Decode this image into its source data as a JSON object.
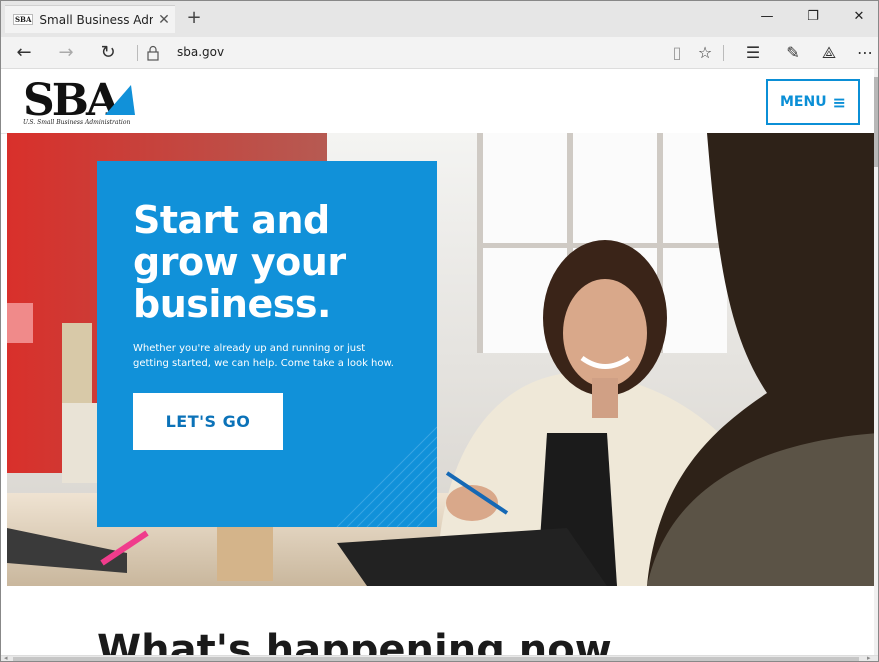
{
  "browser": {
    "tab_title": "Small Business Administ",
    "tab_favicon": "SBA",
    "url": "sba.gov"
  },
  "site": {
    "logo_text": "SBA",
    "logo_tagline": "U.S. Small Business Administration",
    "menu_label": "MENU",
    "menu_icon": "≡"
  },
  "hero": {
    "title": "Start and grow your business.",
    "description": "Whether you're already up and running or just getting started, we can help. Come take a look how.",
    "cta_label": "LET'S GO"
  },
  "section": {
    "heading": "What's happening now"
  },
  "colors": {
    "brand_blue": "#1191d9",
    "link_blue": "#0b8fd6",
    "hero_red": "#d9302b"
  },
  "icons": [
    "close-icon",
    "new-tab-icon",
    "minimize-icon",
    "restore-icon",
    "window-close-icon",
    "back-icon",
    "forward-icon",
    "refresh-icon",
    "lock-icon",
    "reading-view-icon",
    "favorite-star-icon",
    "hub-icon",
    "web-note-icon",
    "share-icon",
    "more-icon",
    "menu-icon"
  ]
}
